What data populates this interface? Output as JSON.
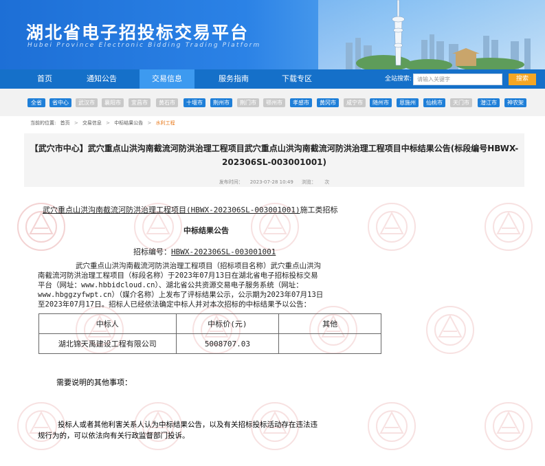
{
  "header": {
    "site_title": "湖北省电子招投标交易平台",
    "site_subtitle": "Hubei Province Electronic Bidding Trading Platform"
  },
  "nav": {
    "items": [
      {
        "label": "首页"
      },
      {
        "label": "通知公告"
      },
      {
        "label": "交易信息",
        "active": true
      },
      {
        "label": "服务指南"
      },
      {
        "label": "下载专区"
      }
    ],
    "search_label": "全站搜索:",
    "search_placeholder": "请输入关键字",
    "search_button": "搜索"
  },
  "regions": [
    {
      "label": "全省",
      "active": true
    },
    {
      "label": "省中心",
      "active": true
    },
    {
      "label": "武汉市",
      "active": false
    },
    {
      "label": "襄阳市",
      "active": false
    },
    {
      "label": "宜昌市",
      "active": false
    },
    {
      "label": "黄石市",
      "active": false
    },
    {
      "label": "十堰市",
      "active": true
    },
    {
      "label": "荆州市",
      "active": true
    },
    {
      "label": "荆门市",
      "active": false
    },
    {
      "label": "鄂州市",
      "active": false
    },
    {
      "label": "孝感市",
      "active": true
    },
    {
      "label": "黄冈市",
      "active": true
    },
    {
      "label": "咸宁市",
      "active": false
    },
    {
      "label": "随州市",
      "active": true
    },
    {
      "label": "恩施州",
      "active": true
    },
    {
      "label": "仙桃市",
      "active": true
    },
    {
      "label": "天门市",
      "active": false
    },
    {
      "label": "潜江市",
      "active": true
    },
    {
      "label": "神农架",
      "active": true
    }
  ],
  "breadcrumb": {
    "prefix": "当前的位置:",
    "items": [
      "首页",
      "交易信息",
      "中标结果公告"
    ],
    "current": "水利工程",
    "separator": ">"
  },
  "notice": {
    "title_line1": "【武穴市中心】武穴重点山洪沟南截流河防洪治理工程项目武穴重点山洪沟南截流河防洪治理工程项目中标结果公告(标段编号HBWX-",
    "title_line2": "202306SL-003001001)",
    "publish_label": "发布时间：",
    "publish_time": "2023-07-28 10:49",
    "views_label": "浏览：",
    "views_unit": "次"
  },
  "body": {
    "project_line": "武穴重点山洪沟南截流河防洪治理工程项目(HBWX-202306SL-003001001)",
    "project_suffix": "施工类招标",
    "heading": "中标结果公告",
    "bid_no_label": "招标编号：",
    "bid_no": "HBWX-202306SL-003001001",
    "paragraph_lines": [
      "武穴重点山洪沟南截流河防洪治理工程项目（招标项目名称）武穴重点山洪沟",
      "南截流河防洪治理工程项目（标段名称）于2023年07月13日在湖北省电子招标投标交易",
      "平台（网址：www.hbbidcloud.cn）、湖北省公共资源交易电子服务系统（网址：",
      "www.hbggzyfwpt.cn）（媒介名称）上发布了评标结果公示，公示期为2023年07月13日",
      "至2023年07月17日。招标人已经依法确定中标人并对本次招标的中标结果予以公告："
    ],
    "table": {
      "headers": [
        "中标人",
        "中标价(元)",
        "其他"
      ],
      "rows": [
        [
          "湖北锦天禹建设工程有限公司",
          "5008707.03",
          ""
        ]
      ]
    },
    "other_items_label": "需要说明的其他事项：",
    "complaint_line1": "投标人或者其他利害关系人认为中标结果公告，以及有关招标投标活动存在违法违",
    "complaint_line2": "规行为的，可以依法向有关行政监督部门投诉。"
  },
  "colors": {
    "nav_bg": "#1570c9",
    "nav_active": "#3d9af0",
    "region_active": "#1f7fd8",
    "region_inactive": "#c9c9c9",
    "search_button": "#f5a623",
    "breadcrumb_current": "#e8791a"
  }
}
